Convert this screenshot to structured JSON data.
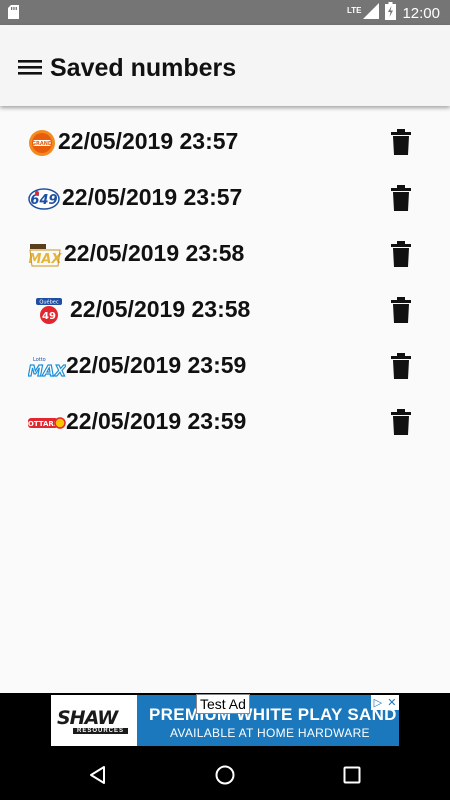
{
  "status_bar": {
    "time": "12:00",
    "network": "LTE",
    "icons": [
      "sd-card-icon",
      "signal-icon",
      "battery-icon"
    ]
  },
  "app_bar": {
    "menu_icon": "hamburger-menu-icon",
    "title": "Saved numbers"
  },
  "saved_entries": [
    {
      "lottery_logo": "daily-grand-logo",
      "date": "22/05/2019 23:57",
      "action_icon": "trash-icon"
    },
    {
      "lottery_logo": "lotto-649-logo",
      "date": "22/05/2019 23:57",
      "action_icon": "trash-icon"
    },
    {
      "lottery_logo": "lotto-max-gold-logo",
      "date": "22/05/2019 23:58",
      "action_icon": "trash-icon"
    },
    {
      "lottery_logo": "quebec-49-logo",
      "date": "22/05/2019 23:58",
      "action_icon": "trash-icon"
    },
    {
      "lottery_logo": "lotto-max-logo",
      "date": "22/05/2019 23:59",
      "action_icon": "trash-icon"
    },
    {
      "lottery_logo": "lottario-logo",
      "date": "22/05/2019 23:59",
      "action_icon": "trash-icon"
    }
  ],
  "ad": {
    "badge": "Test Ad",
    "advertiser_logo": "SHAW",
    "advertiser_sub": "RESOURCES",
    "headline": "PREMIUM WHITE PLAY SAND",
    "subline": "AVAILABLE AT HOME HARDWARE",
    "choices_icons": [
      "adchoices-icon",
      "close-icon"
    ],
    "background_color": "#1b78bd"
  },
  "nav_bar": {
    "buttons": [
      "back-icon",
      "home-icon",
      "recents-icon"
    ]
  },
  "colors": {
    "status_bar": "#757575",
    "app_bar": "#f5f5f5",
    "background": "#fafafa",
    "text": "#111111"
  }
}
